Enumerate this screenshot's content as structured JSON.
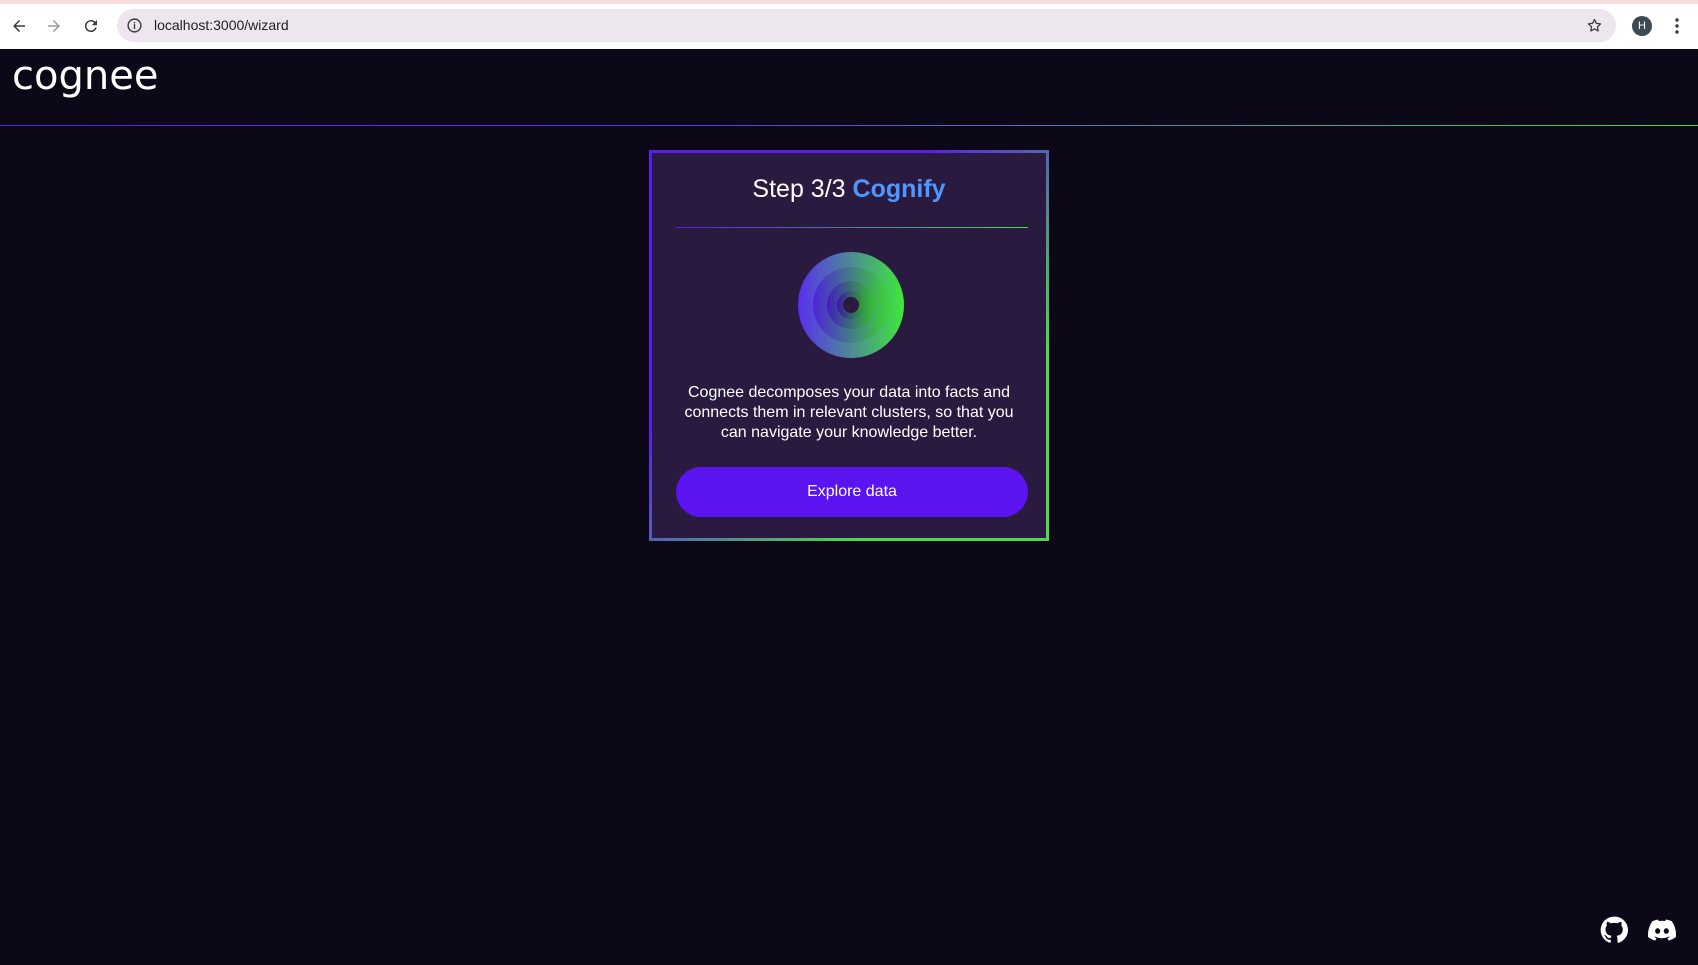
{
  "browser": {
    "url": "localhost:3000/wizard",
    "profile_initial": "H"
  },
  "header": {
    "logo_text": "cognee"
  },
  "wizard": {
    "step_label": "Step 3/3",
    "step_name": "Cognify",
    "description": "Cognee decomposes your data into facts and connects them in relevant clusters, so that you can navigate your knowledge better.",
    "button_label": "Explore data"
  },
  "footer": {
    "icons": [
      "github-icon",
      "discord-icon"
    ]
  },
  "colors": {
    "background": "#0c0818",
    "card_background": "#2a1a40",
    "accent_purple": "#5b14ef",
    "accent_green": "#4bd94a",
    "step_name": "#4f97ff"
  }
}
